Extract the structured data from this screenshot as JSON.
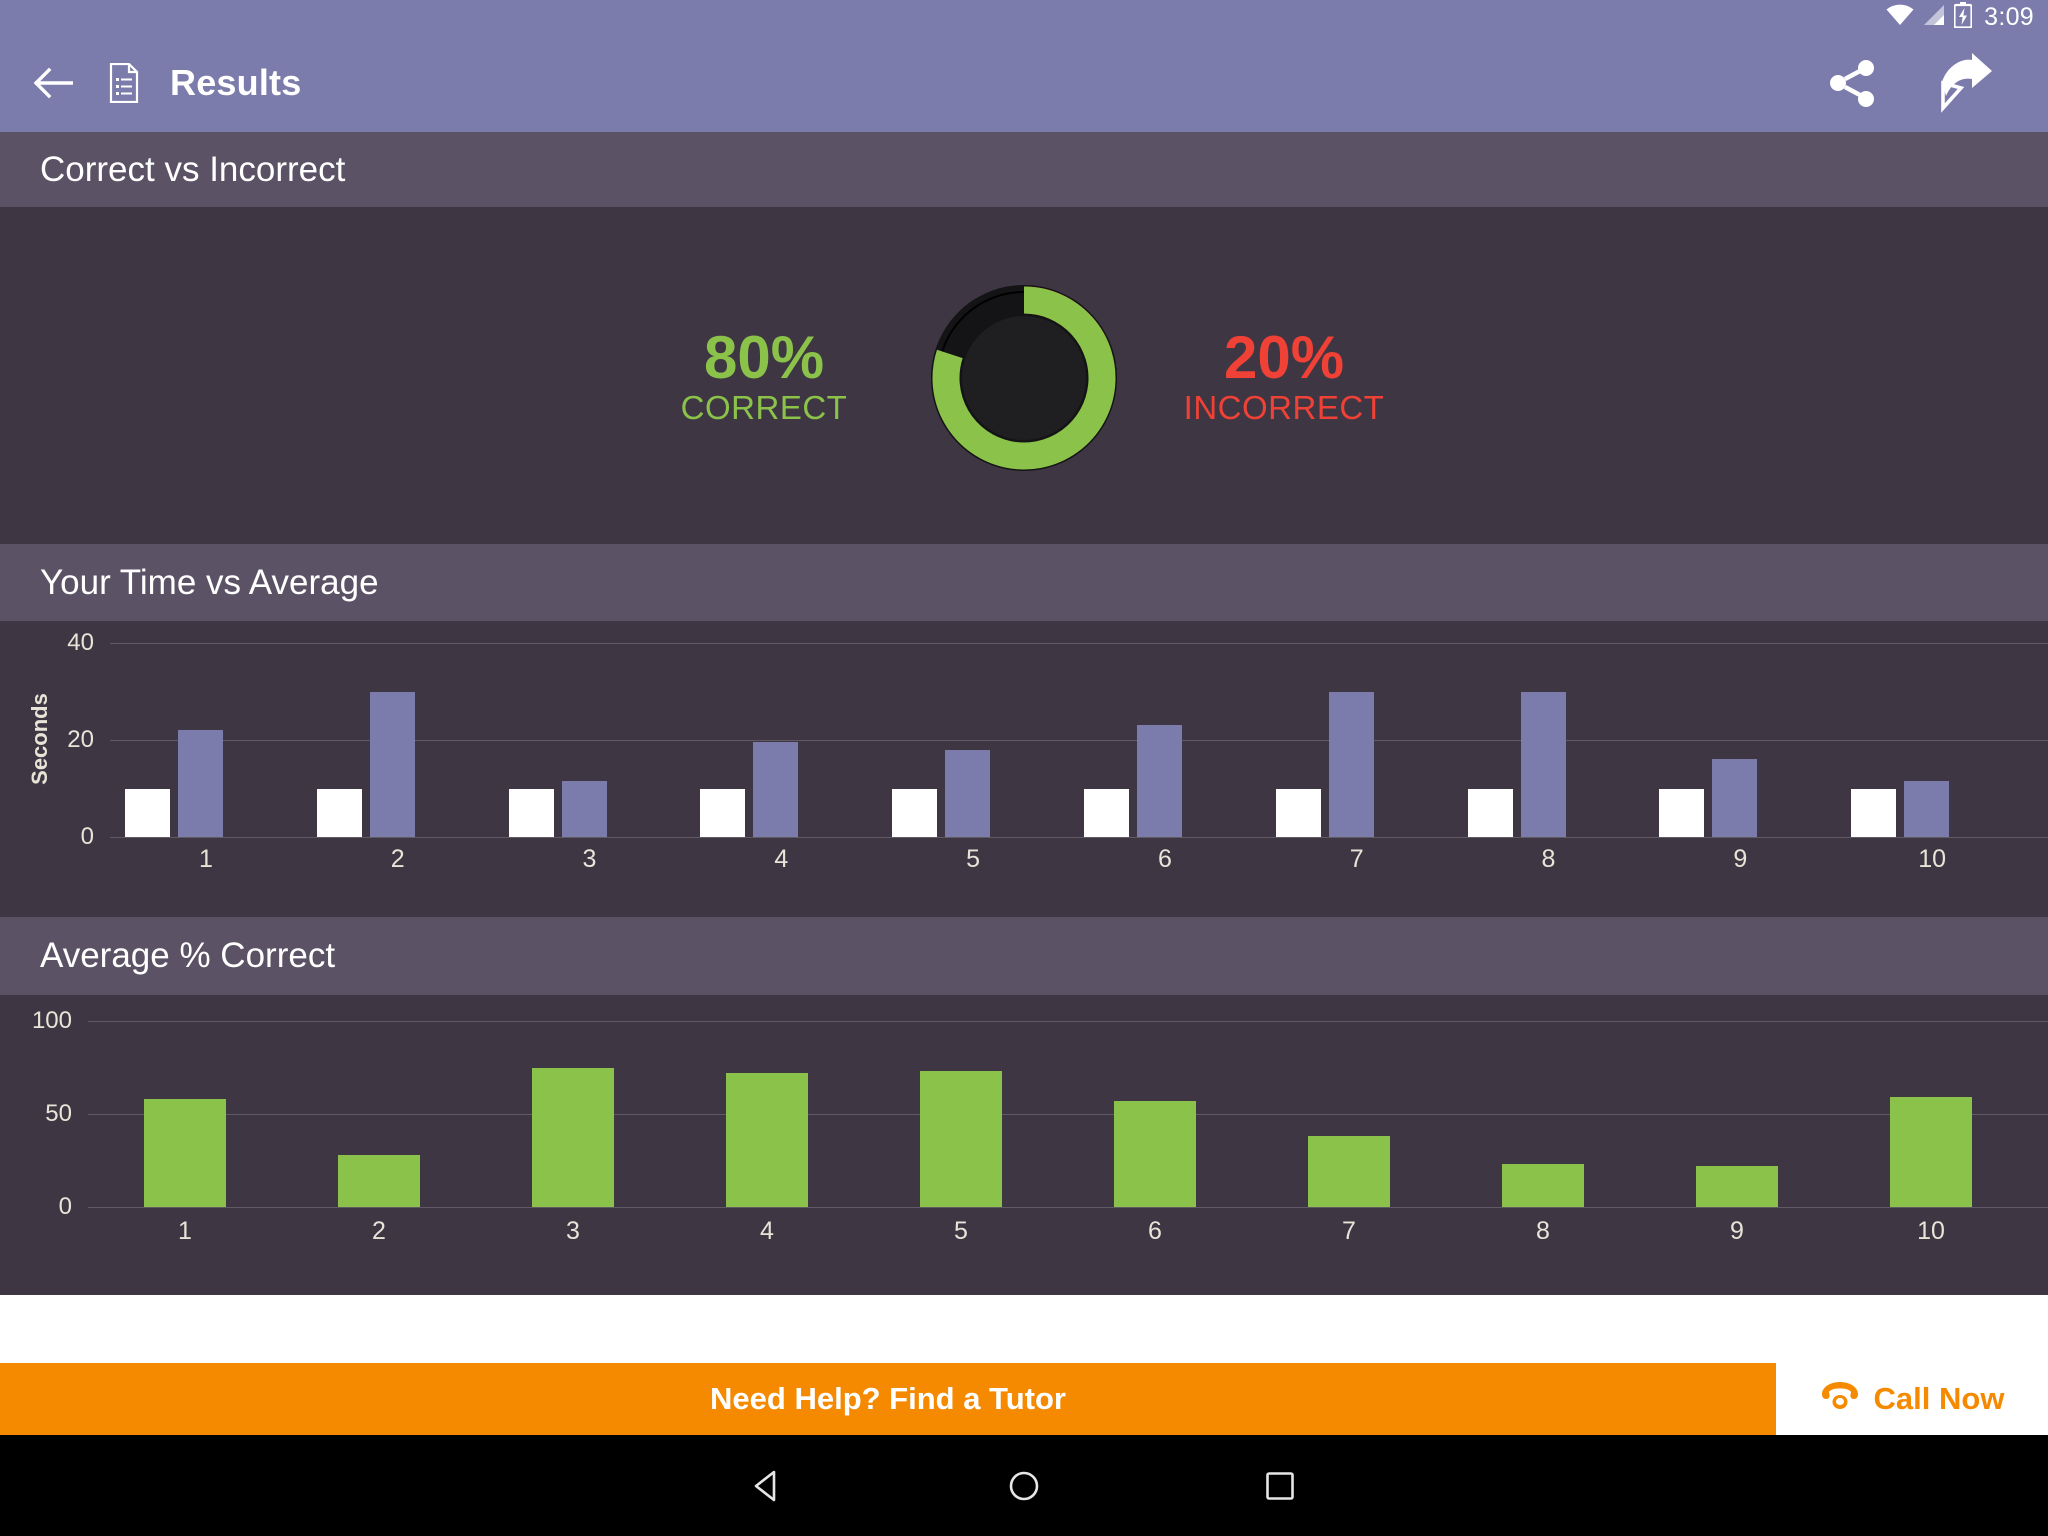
{
  "statusbar": {
    "time": "3:09",
    "icons": [
      "wifi-icon",
      "cellular-signal-icon",
      "battery-charging-icon"
    ]
  },
  "appbar": {
    "back_label": "back-arrow",
    "doc_icon": "document-icon",
    "title": "Results",
    "share_label": "share-icon",
    "next_label": "forward-arrow-icon"
  },
  "sections": {
    "correct_vs_incorrect": "Correct vs Incorrect",
    "your_time_vs_average": "Your Time vs Average",
    "average_percent_correct": "Average % Correct"
  },
  "colors": {
    "appbar": "#7b7cab",
    "section_header": "#5b5265",
    "panel": "#3e3643",
    "correct_green": "#8bc34a",
    "incorrect_red": "#ef4136",
    "average_purple": "#7b7cab",
    "your_time_white": "#ffffff",
    "ad_orange": "#f58a00",
    "donut_center": "#1f1f22"
  },
  "donut": {
    "correct_value": "80%",
    "correct_label": "CORRECT",
    "incorrect_value": "20%",
    "incorrect_label": "INCORRECT",
    "correct_pct": 80,
    "incorrect_pct": 20
  },
  "ad": {
    "headline": "Need Help? Find a Tutor",
    "call_label": "Call Now",
    "phone_icon": "phone-icon"
  },
  "navbar": {
    "back": "triangle-back-icon",
    "home": "circle-home-icon",
    "recents": "square-recents-icon"
  },
  "chart_data": [
    {
      "id": "time_vs_average",
      "type": "bar",
      "title": "Your Time vs Average",
      "xlabel": "",
      "ylabel": "Seconds",
      "categories": [
        "1",
        "2",
        "3",
        "4",
        "5",
        "6",
        "7",
        "8",
        "9",
        "10"
      ],
      "ylim": [
        0,
        40
      ],
      "yticks": [
        0,
        20,
        40
      ],
      "grid": true,
      "legend": "none",
      "series": [
        {
          "name": "Your Time",
          "color": "#ffffff",
          "values": [
            10,
            10,
            10,
            10,
            10,
            10,
            10,
            10,
            10,
            10
          ]
        },
        {
          "name": "Average",
          "color": "#7b7cab",
          "values": [
            22,
            30,
            11.5,
            19.5,
            18,
            23,
            30,
            30,
            16,
            11.5
          ]
        }
      ]
    },
    {
      "id": "average_percent_correct",
      "type": "bar",
      "title": "Average % Correct",
      "xlabel": "",
      "ylabel": "",
      "categories": [
        "1",
        "2",
        "3",
        "4",
        "5",
        "6",
        "7",
        "8",
        "9",
        "10"
      ],
      "ylim": [
        0,
        100
      ],
      "yticks": [
        0,
        50,
        100
      ],
      "grid": true,
      "legend": "none",
      "series": [
        {
          "name": "Average % Correct",
          "color": "#8bc34a",
          "values": [
            58,
            28,
            75,
            72,
            73,
            57,
            38,
            23,
            22,
            59
          ]
        }
      ]
    }
  ]
}
